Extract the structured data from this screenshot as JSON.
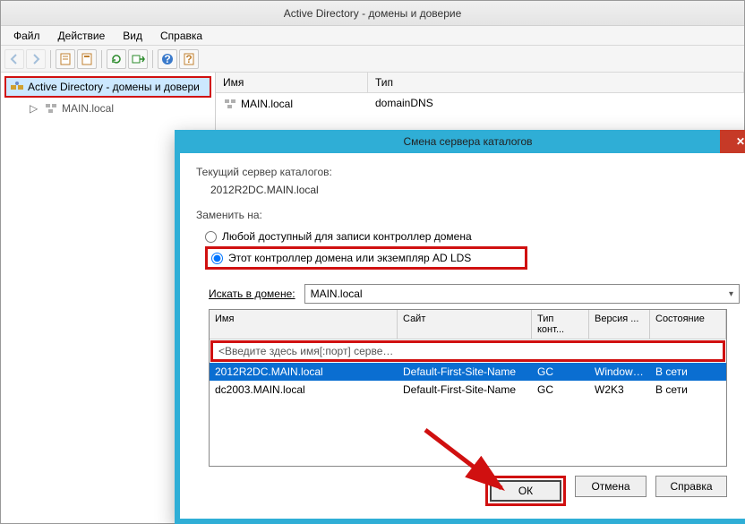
{
  "window": {
    "title": "Active Directory - домены и доверие"
  },
  "menu": {
    "file": "Файл",
    "action": "Действие",
    "view": "Вид",
    "help": "Справка"
  },
  "icons": {
    "back": "←",
    "forward": "→",
    "open": "📄",
    "props": "📋",
    "refresh": "↻",
    "export": "⇨",
    "help": "?"
  },
  "tree": {
    "root": "Active Directory - домены и довери",
    "child": "MAIN.local"
  },
  "list": {
    "headers": {
      "name": "Имя",
      "type": "Тип"
    },
    "rows": [
      {
        "name": "MAIN.local",
        "type": "domainDNS"
      }
    ]
  },
  "dialog": {
    "title": "Смена сервера каталогов",
    "current_label": "Текущий сервер каталогов:",
    "current_value": "2012R2DC.MAIN.local",
    "replace_label": "Заменить на:",
    "radio_any": "Любой доступный для записи контроллер домена",
    "radio_this": "Этот контроллер домена или экземпляр AD LDS",
    "search_label": "Искать в домене:",
    "search_value": "MAIN.local",
    "dc_headers": {
      "name": "Имя",
      "site": "Сайт",
      "type": "Тип конт...",
      "version": "Версия ...",
      "state": "Состояние"
    },
    "dc_rows": [
      {
        "name": "<Введите здесь имя[:порт] сервера кат...",
        "site": "",
        "type": "",
        "version": "",
        "state": "",
        "kind": "placeholder"
      },
      {
        "name": "2012R2DC.MAIN.local",
        "site": "Default-First-Site-Name",
        "type": "GC",
        "version": "Windows...",
        "state": "В сети",
        "kind": "selected"
      },
      {
        "name": "dc2003.MAIN.local",
        "site": "Default-First-Site-Name",
        "type": "GC",
        "version": "W2K3",
        "state": "В сети",
        "kind": "normal"
      }
    ],
    "buttons": {
      "ok": "ОК",
      "cancel": "Отмена",
      "help": "Справка"
    }
  }
}
